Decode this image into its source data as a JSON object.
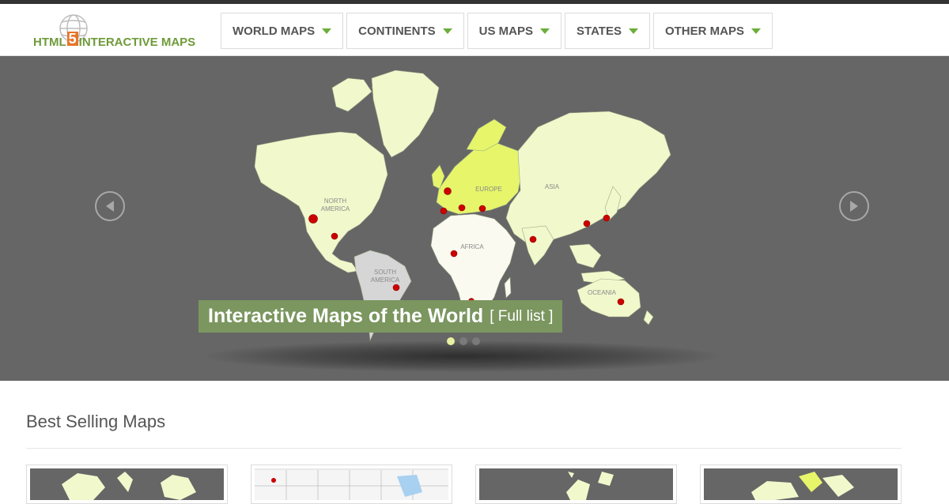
{
  "header": {
    "logo": {
      "text_before": "HTML",
      "text_five": "5",
      "text_after": "INTERACTIVE MAPS"
    },
    "nav": [
      {
        "label": "WORLD MAPS"
      },
      {
        "label": "CONTINENTS"
      },
      {
        "label": "US MAPS"
      },
      {
        "label": "STATES"
      },
      {
        "label": "OTHER MAPS"
      }
    ]
  },
  "hero": {
    "caption_title": "Interactive Maps of the World",
    "caption_link": "[ Full list ]",
    "map_labels": {
      "north_america_1": "NORTH",
      "north_america_2": "AMERICA",
      "south_america_1": "SOUTH",
      "south_america_2": "AMERICA",
      "europe": "EUROPE",
      "asia": "ASIA",
      "africa": "AFRICA",
      "oceania": "OCEANIA"
    },
    "slides": 3,
    "active_slide": 1
  },
  "best_selling": {
    "title": "Best Selling Maps"
  },
  "colors": {
    "accent_green": "#6cae3a",
    "caption_bg": "#7b965f",
    "hero_bg": "#666666",
    "land": "#f1f8cc",
    "europe": "#e6f56a",
    "south_america": "#d6d6d6",
    "africa": "#fafaf0",
    "city": "#cc0000"
  },
  "icons": {
    "prev": "chevron-left-circle-icon",
    "next": "chevron-right-circle-icon",
    "logo": "globe-icon"
  }
}
